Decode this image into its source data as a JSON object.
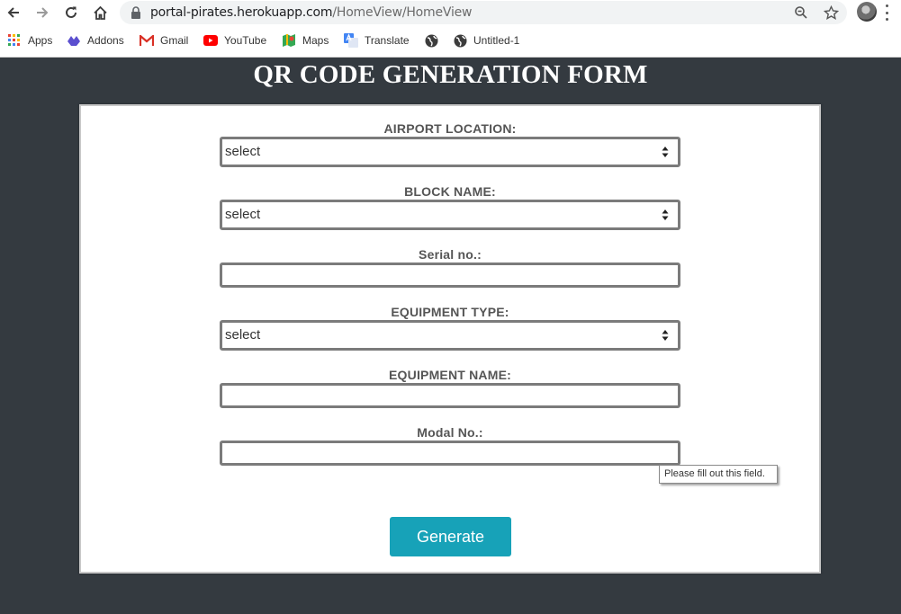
{
  "browser": {
    "url_host": "portal-pirates.herokuapp.com",
    "url_path": "/HomeView/HomeView",
    "bookmarks": [
      {
        "label": "Apps",
        "icon": "apps-grid-icon"
      },
      {
        "label": "Addons",
        "icon": "addons-icon"
      },
      {
        "label": "Gmail",
        "icon": "gmail-icon"
      },
      {
        "label": "YouTube",
        "icon": "youtube-icon"
      },
      {
        "label": "Maps",
        "icon": "maps-icon"
      },
      {
        "label": "Translate",
        "icon": "translate-icon"
      },
      {
        "label": "",
        "icon": "globe-icon"
      },
      {
        "label": "Untitled-1",
        "icon": "globe-icon"
      }
    ]
  },
  "page": {
    "title": "QR CODE GENERATION FORM"
  },
  "form": {
    "airport_location": {
      "label": "AIRPORT LOCATION:",
      "value": "select"
    },
    "block_name": {
      "label": "BLOCK NAME:",
      "value": "select"
    },
    "serial_no": {
      "label": "Serial no.:",
      "value": ""
    },
    "equipment_type": {
      "label": "EQUIPMENT TYPE:",
      "value": "select"
    },
    "equipment_name": {
      "label": "EQUIPMENT NAME:",
      "value": ""
    },
    "modal_no": {
      "label": "Modal No.:",
      "value": ""
    },
    "validation_tooltip": "Please fill out this field.",
    "generate_label": "Generate"
  },
  "colors": {
    "page_background": "#343a40",
    "button": "#17a2b8",
    "field_border": "#7b7b7b"
  }
}
